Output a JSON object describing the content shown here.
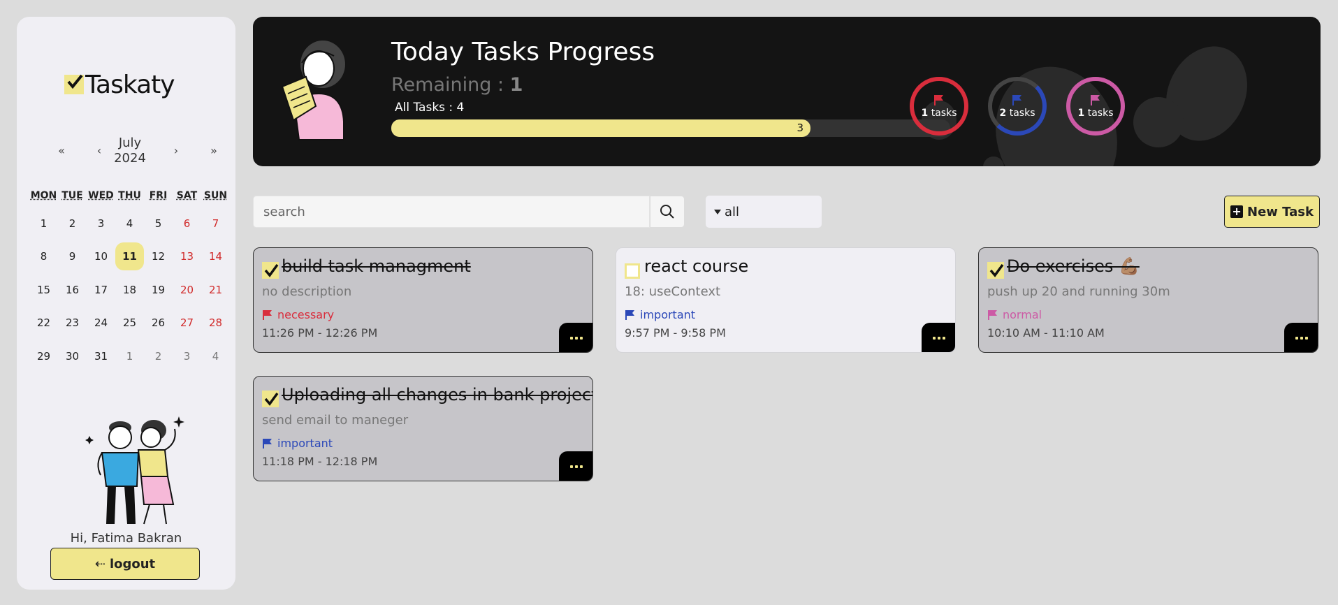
{
  "app": {
    "name": "Taskaty"
  },
  "calendar": {
    "month": "July",
    "year": "2024",
    "nav": {
      "prev_year": "«",
      "prev_month": "‹",
      "next_month": "›",
      "next_year": "»"
    },
    "weekdays": [
      "MON",
      "TUE",
      "WED",
      "THU",
      "FRI",
      "SAT",
      "SUN"
    ],
    "weeks": [
      [
        "1",
        "2",
        "3",
        "4",
        "5",
        "6",
        "7"
      ],
      [
        "8",
        "9",
        "10",
        "11",
        "12",
        "13",
        "14"
      ],
      [
        "15",
        "16",
        "17",
        "18",
        "19",
        "20",
        "21"
      ],
      [
        "22",
        "23",
        "24",
        "25",
        "26",
        "27",
        "28"
      ],
      [
        "29",
        "30",
        "31",
        "1",
        "2",
        "3",
        "4"
      ]
    ],
    "today": "11"
  },
  "user": {
    "greeting": "Hi, Fatima Bakran",
    "logout_label": "logout",
    "logout_icon": "logout-arrow-icon"
  },
  "progress": {
    "title": "Today Tasks Progress",
    "remaining_label": "Remaining :",
    "remaining_value": "1",
    "all_tasks_label": "All Tasks : 4",
    "completed": 3,
    "total": 4,
    "completed_label": "3"
  },
  "priority_summary": [
    {
      "count": "1",
      "unit": "tasks",
      "color": "#d92d3c",
      "icon": "flag-icon"
    },
    {
      "count": "2",
      "unit": "tasks",
      "color": "#2b48b8",
      "icon": "flag-icon"
    },
    {
      "count": "1",
      "unit": "tasks",
      "color": "#cc5aa5",
      "icon": "flag-icon"
    }
  ],
  "toolbar": {
    "search_placeholder": "search",
    "search_icon": "search-icon",
    "filter_value": "all",
    "new_task_label": "New Task"
  },
  "tasks": [
    {
      "title": "build task managment",
      "done": true,
      "description": "no description",
      "priority": "necessary",
      "priority_color": "#d92d3c",
      "time": "11:26 PM - 12:26 PM"
    },
    {
      "title": "react course",
      "done": false,
      "description": "18: useContext",
      "priority": "important",
      "priority_color": "#2b48b8",
      "time": "9:57 PM - 9:58 PM"
    },
    {
      "title": "Do exercises 💪🏽",
      "done": true,
      "description": "push up 20 and running 30m",
      "priority": "normal",
      "priority_color": "#cc5aa5",
      "time": "10:10 AM - 11:10 AM"
    },
    {
      "title": "Uploading all changes in bank project",
      "done": true,
      "description": "send email to maneger",
      "priority": "important",
      "priority_color": "#2b48b8",
      "time": "11:18 PM - 12:18 PM"
    }
  ]
}
